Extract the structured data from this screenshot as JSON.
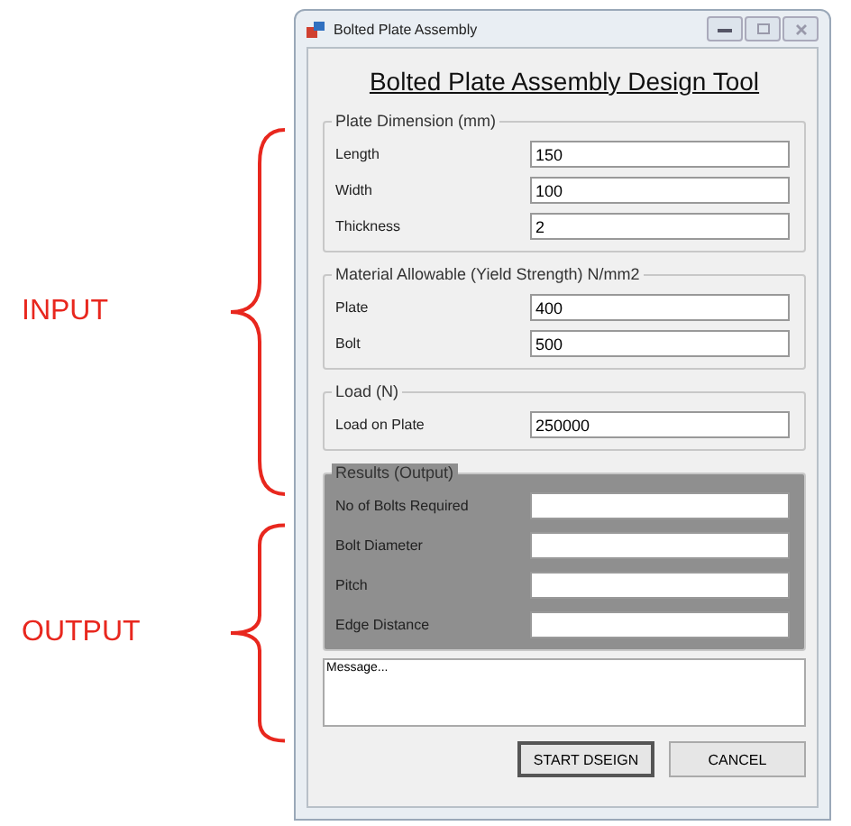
{
  "annotations": [
    {
      "label": "INPUT",
      "kind": "input"
    },
    {
      "label": "OUTPUT",
      "kind": "output"
    }
  ],
  "window": {
    "title": "Bolted Plate Assembly",
    "heading": "Bolted Plate Assembly Design Tool"
  },
  "groups": [
    {
      "title": "Plate Dimension (mm)",
      "kind": "input",
      "fields": [
        {
          "label": "Length",
          "value": "150"
        },
        {
          "label": "Width",
          "value": "100"
        },
        {
          "label": "Thickness",
          "value": "2"
        }
      ]
    },
    {
      "title": "Material Allowable (Yield Strength) N/mm2",
      "kind": "input",
      "fields": [
        {
          "label": "Plate",
          "value": "400"
        },
        {
          "label": "Bolt",
          "value": "500"
        }
      ]
    },
    {
      "title": "Load (N)",
      "kind": "input",
      "fields": [
        {
          "label": "Load on Plate",
          "value": "250000"
        }
      ]
    },
    {
      "title": "Results (Output)",
      "kind": "output",
      "fields": [
        {
          "label": "No of Bolts Required"
        },
        {
          "label": "Bolt Diameter"
        },
        {
          "label": "Pitch"
        },
        {
          "label": "Edge Distance"
        }
      ]
    }
  ],
  "message": {
    "value": "Message..."
  },
  "buttons": [
    {
      "label": "START DSEIGN",
      "selected": true
    },
    {
      "label": "CANCEL",
      "selected": false
    }
  ]
}
